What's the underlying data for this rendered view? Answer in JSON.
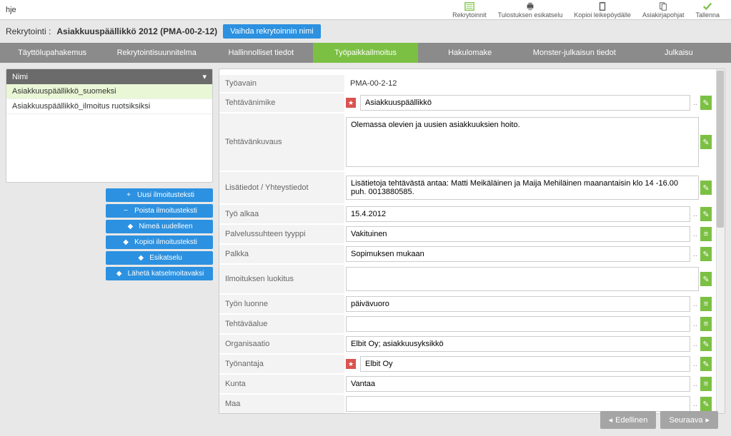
{
  "topbar": {
    "help": "hje",
    "buttons": [
      {
        "name": "rekrytoinnit",
        "label": "Rekrytoinnit"
      },
      {
        "name": "tulostuksen-esikatselu",
        "label": "Tulostuksen esikatselu"
      },
      {
        "name": "kopioi-leikepoydalle",
        "label": "Kopioi leikepöydälle"
      },
      {
        "name": "asiakirjapohjat",
        "label": "Asiakirjapohjat"
      },
      {
        "name": "tallenna",
        "label": "Tallenna"
      }
    ]
  },
  "breadcrumb": {
    "prefix": "Rekrytointi :",
    "title": "Asiakkuuspäällikkö 2012 (PMA-00-2-12)",
    "rename": "Vaihda rekrytoinnin nimi"
  },
  "tabs": [
    "Täyttölupahakemus",
    "Rekrytointisuunnitelma",
    "Hallinnolliset tiedot",
    "Työpaikkailmoitus",
    "Hakulomake",
    "Monster-julkaisun tiedot",
    "Julkaisu"
  ],
  "active_tab_index": 3,
  "sidebar": {
    "header": "Nimi",
    "items": [
      "Asiakkuuspäällikkö_suomeksi",
      "Asiakkuuspäällikkö_ilmoitus ruotsiksiksi"
    ],
    "actions": [
      {
        "sym": "+",
        "label": "Uusi ilmoitusteksti"
      },
      {
        "sym": "−",
        "label": "Poista ilmoitusteksti"
      },
      {
        "sym": "◆",
        "label": "Nimeä uudelleen"
      },
      {
        "sym": "◆",
        "label": "Kopioi ilmoitusteksti"
      },
      {
        "sym": "◆",
        "label": "Esikatselu"
      },
      {
        "sym": "◆",
        "label": "Lähetä katselmoitavaksi"
      }
    ]
  },
  "form": {
    "tyoavain_label": "Työavain",
    "tyoavain_value": "PMA-00-2-12",
    "tehtavanimike_label": "Tehtävänimike",
    "tehtavanimike_value": "Asiakkuuspäällikkö",
    "tehtavankuvaus_label": "Tehtävänkuvaus",
    "tehtavankuvaus_value": "Olemassa olevien ja uusien asiakkuuksien hoito.",
    "lisatiedot_label": "Lisätiedot / Yhteystiedot",
    "lisatiedot_value": "Lisätietoja tehtävästä antaa: Matti Meikäläinen ja Maija Mehiläinen maanantaisin klo 14 -16.00 puh. 0013880585.",
    "tyo_alkaa_label": "Työ alkaa",
    "tyo_alkaa_value": "15.4.2012",
    "palvelussuhteen_label": "Palvelussuhteen tyyppi",
    "palvelussuhteen_value": "Vakituinen",
    "palkka_label": "Palkka",
    "palkka_value": "Sopimuksen mukaan",
    "ilmoituksen_luokitus_label": "Ilmoituksen luokitus",
    "ilmoituksen_luokitus_value": "",
    "tyon_luonne_label": "Työn luonne",
    "tyon_luonne_value": "päivävuoro",
    "tehtavaalue_label": "Tehtäväalue",
    "tehtavaalue_value": "",
    "organisaatio_label": "Organisaatio",
    "organisaatio_value": "Elbit Oy; asiakkuusyksikkö",
    "tyonantaja_label": "Työnantaja",
    "tyonantaja_value": "Elbit Oy",
    "kunta_label": "Kunta",
    "kunta_value": "Vantaa",
    "maa_label": "Maa",
    "maa_value": ""
  },
  "footer": {
    "prev": "Edellinen",
    "next": "Seuraava"
  }
}
